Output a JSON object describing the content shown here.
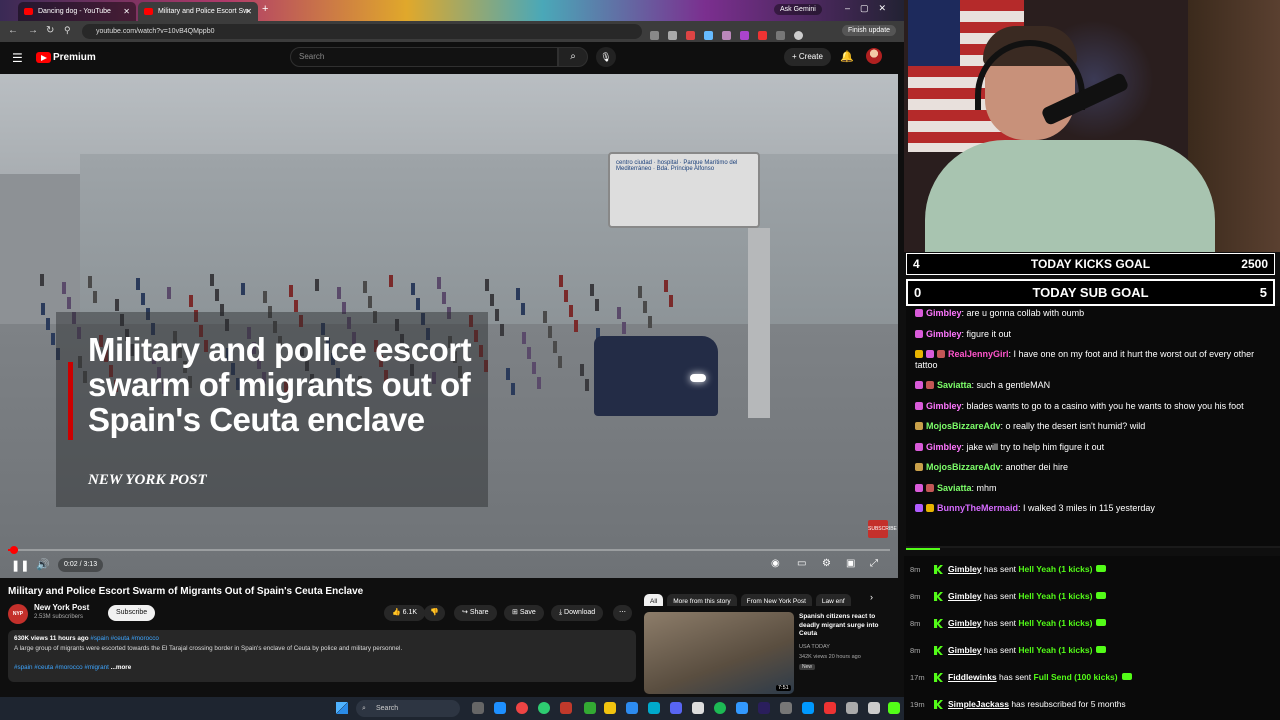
{
  "browser": {
    "tabs": [
      {
        "title": "Dancing dog - YouTube"
      },
      {
        "title": "Military and Police Escort Sw"
      }
    ],
    "ask_gemini": "Ask Gemini",
    "url": "youtube.com/watch?v=10vB4QMppb0",
    "finish_update": "Finish update"
  },
  "youtube": {
    "logo_text": "Premium",
    "search_placeholder": "Search",
    "create_label": "Create",
    "video": {
      "overlay_title": "Military and police escort swarm of migrants out of Spain's Ceuta enclave",
      "overlay_source": "NEW YORK POST",
      "time_label": "0:02 / 3:13",
      "progress": 0.011,
      "corner_badge": "SUBSCRIBE"
    },
    "title": "Military and Police Escort Swarm of Migrants Out of Spain's Ceuta Enclave",
    "channel": {
      "avatar_text": "NEW YORK POST",
      "name": "New York Post",
      "subscribers": "2.53M subscribers",
      "subscribe_label": "Subscribe"
    },
    "actions": {
      "likes": "6.1K",
      "share": "Share",
      "save": "Save",
      "download": "Download"
    },
    "description": {
      "meta": "630K views  11 hours ago",
      "meta_tags": "#spain #ceuta #morocco",
      "text": "A large group of migrants were escorted towards the El Tarajal crossing border in Spain's enclave of Ceuta by police and military personnel.",
      "tags": "#spain #ceuta #morocco #migrant",
      "more": "...more"
    },
    "chips": [
      "All",
      "More from this story",
      "From New York Post",
      "Law enf"
    ],
    "recommended": {
      "title": "Spanish citizens react to deadly migrant surge into Ceuta",
      "channel": "USA TODAY",
      "views": "342K views  20 hours ago",
      "badge": "New",
      "duration": "7:51"
    }
  },
  "taskbar": {
    "search_label": "Search"
  },
  "goals": {
    "kicks": {
      "current": "4",
      "label": "TODAY KICKS GOAL",
      "target": "2500"
    },
    "subs": {
      "current": "0",
      "label": "TODAY SUB GOAL",
      "target": "5"
    }
  },
  "chat": [
    {
      "user": "Gimbley",
      "text": ": are u gonna collab with oumb",
      "color": "#ff77ff",
      "badges": [
        "#d95bd9"
      ]
    },
    {
      "user": "Gimbley",
      "text": ": figure it out",
      "color": "#ff77ff",
      "badges": [
        "#d95bd9"
      ]
    },
    {
      "user": "RealJennyGirl",
      "text": ": I have one on my foot and it hurt the worst out of every other tattoo",
      "color": "#ff55cc",
      "badges": [
        "#e8b400",
        "#d95bd9",
        "#c35656"
      ]
    },
    {
      "user": "Saviatta",
      "text": ": such a gentleMAN",
      "color": "#7dff6a",
      "badges": [
        "#d95bd9",
        "#c35656"
      ]
    },
    {
      "user": "Gimbley",
      "text": ": blades wants to go to a casino with you he wants to show you his foot",
      "color": "#ff77ff",
      "badges": [
        "#d95bd9"
      ]
    },
    {
      "user": "MojosBizzareAdv",
      "text": ": o really the desert isn't humid? wild",
      "color": "#7dff6a",
      "badges": [
        "#c9a04a"
      ]
    },
    {
      "user": "Gimbley",
      "text": ": jake will try to help him figure it out",
      "color": "#ff77ff",
      "badges": [
        "#d95bd9"
      ]
    },
    {
      "user": "MojosBizzareAdv",
      "text": ": another dei hire",
      "color": "#7dff6a",
      "badges": [
        "#c9a04a"
      ]
    },
    {
      "user": "Saviatta",
      "text": ": mhm",
      "color": "#7dff6a",
      "badges": [
        "#d95bd9",
        "#c35656"
      ]
    },
    {
      "user": "BunnyTheMermaid",
      "text": ": I walked 3 miles in 115 yesterday",
      "color": "#d66bff",
      "badges": [
        "#b15cff",
        "#e8b400"
      ]
    }
  ],
  "events": [
    {
      "time": "8m",
      "user": "Gimbley",
      "action": " has sent ",
      "gift": "Hell Yeah (1 kicks)"
    },
    {
      "time": "8m",
      "user": "Gimbley",
      "action": " has sent ",
      "gift": "Hell Yeah (1 kicks)"
    },
    {
      "time": "8m",
      "user": "Gimbley",
      "action": " has sent ",
      "gift": "Hell Yeah (1 kicks)"
    },
    {
      "time": "8m",
      "user": "Gimbley",
      "action": " has sent ",
      "gift": "Hell Yeah (1 kicks)"
    },
    {
      "time": "17m",
      "user": "Fiddlewinks",
      "action": " has sent ",
      "gift": "Full Send (100 kicks)"
    },
    {
      "time": "19m",
      "user": "SimpleJackass",
      "action": " has resubscribed for 5 months",
      "gift": ""
    }
  ],
  "colors": {
    "kick_green": "#53fc18",
    "yt_red": "#ff0000"
  }
}
